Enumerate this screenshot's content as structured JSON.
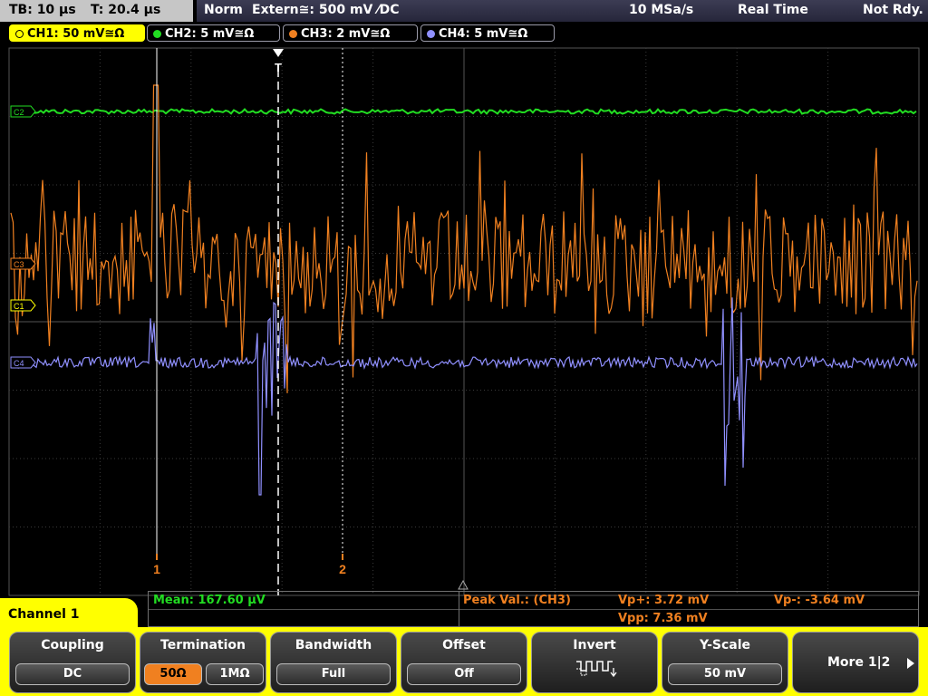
{
  "topbar": {
    "timebase": "TB: 10 µs",
    "trigger_time": "T: 20.4 µs",
    "mode": "Norm",
    "trigger_source": "Extern≅: 500 mV ⁄DC",
    "sample_rate": "10 MSa/s",
    "acq_mode": "Real Time",
    "status": "Not Rdy."
  },
  "channels": [
    {
      "label": "CH1: 50 mV≅Ω",
      "color": "#ffff00",
      "active": true
    },
    {
      "label": "CH2: 5 mV≅Ω",
      "color": "#22dd22",
      "active": false
    },
    {
      "label": "CH3: 2 mV≅Ω",
      "color": "#f08020",
      "active": false
    },
    {
      "label": "CH4: 5 mV≅Ω",
      "color": "#9090ff",
      "active": false
    }
  ],
  "display": {
    "markers": {
      "ch2": "C2",
      "ch3": "C3",
      "ch1": "C1",
      "ch4": "C4"
    },
    "trigger_marker": "T",
    "cursor1": "1",
    "cursor2": "2",
    "colors": {
      "ch1": "#ffff00",
      "ch2": "#22dd22",
      "ch3": "#f08020",
      "ch4": "#9090ff",
      "grid": "#3a3a3a",
      "cursor": "#f08020"
    }
  },
  "measure": {
    "mean": "Mean: 167.60 µV",
    "peak_label": "Peak Val.: (CH3)",
    "vp_plus": "Vp+: 3.72 mV",
    "vp_minus": "Vp-: -3.64 mV",
    "vpp": "Vpp: 7.36 mV"
  },
  "menu": {
    "title": "Channel 1",
    "coupling": {
      "title": "Coupling",
      "value": "DC"
    },
    "termination": {
      "title": "Termination",
      "options": [
        "50Ω",
        "1MΩ"
      ],
      "selected": "50Ω"
    },
    "bandwidth": {
      "title": "Bandwidth",
      "value": "Full"
    },
    "offset": {
      "title": "Offset",
      "value": "Off"
    },
    "invert": {
      "title": "Invert",
      "icon": "square-wave-invert-icon"
    },
    "yscale": {
      "title": "Y-Scale",
      "value": "50 mV"
    },
    "more": {
      "label": "More 1|2",
      "icon": "play-right-icon"
    }
  }
}
